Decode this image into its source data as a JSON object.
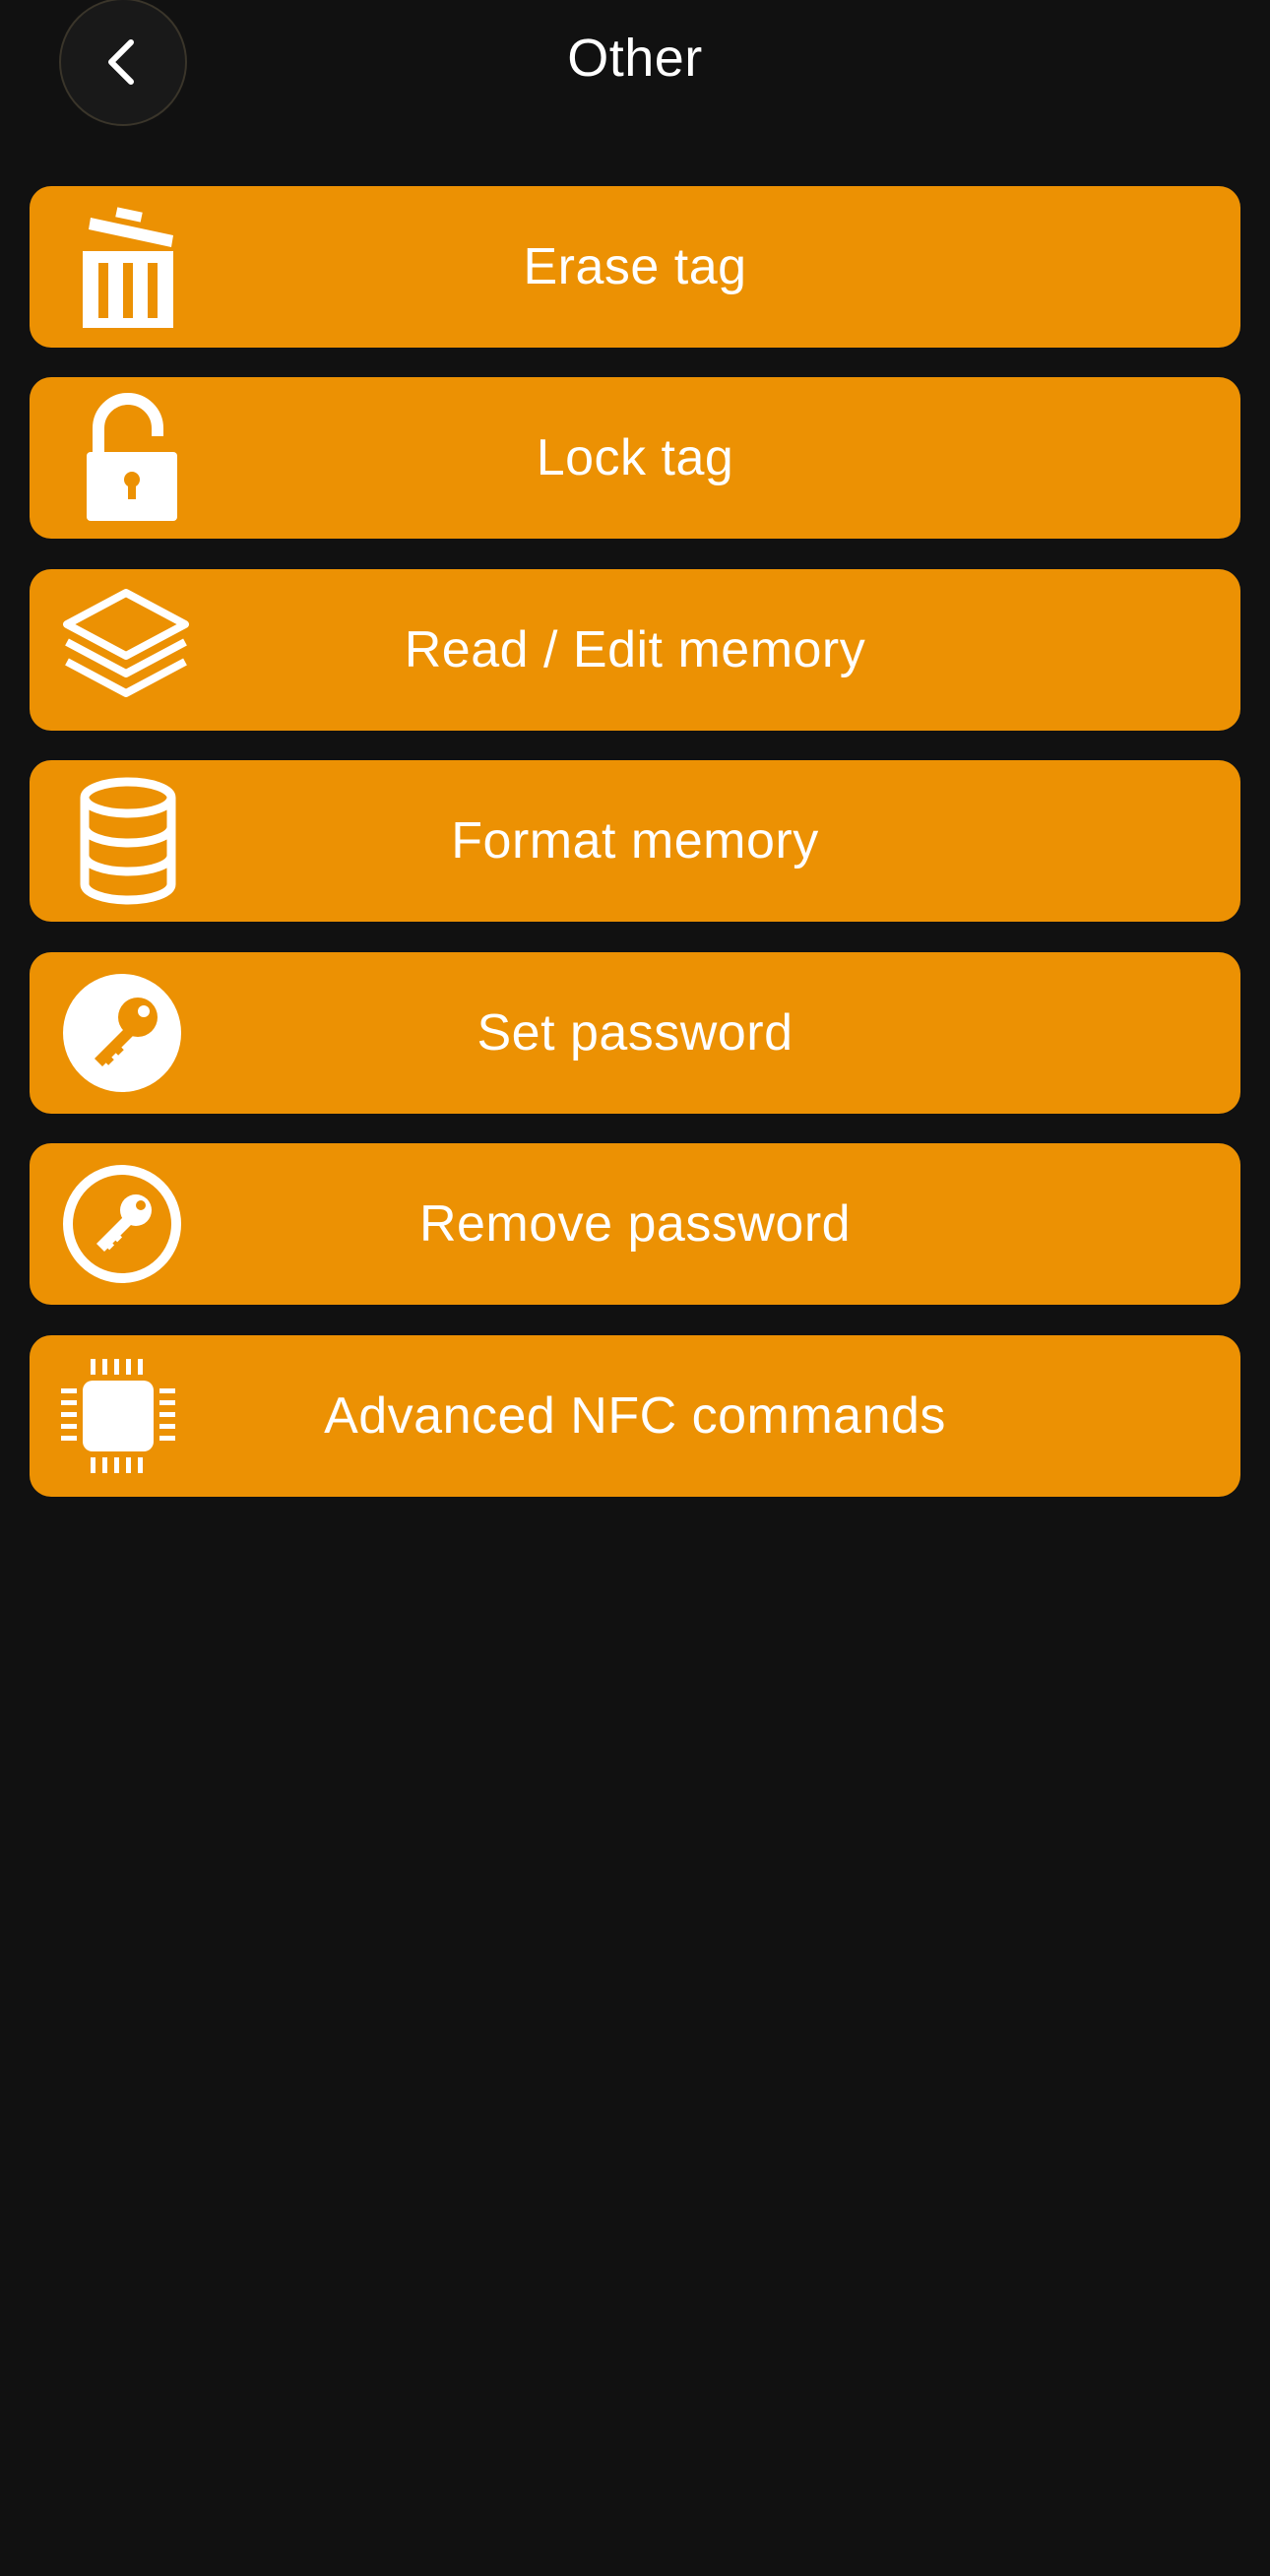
{
  "header": {
    "title": "Other",
    "back_icon": "chevron-left-icon"
  },
  "colors": {
    "background": "#111111",
    "accent": "#ec9103",
    "text": "#ffffff"
  },
  "menu": {
    "items": [
      {
        "label": "Erase tag",
        "icon": "trash-icon"
      },
      {
        "label": "Lock tag",
        "icon": "unlock-icon"
      },
      {
        "label": "Read / Edit memory",
        "icon": "layers-icon"
      },
      {
        "label": "Format memory",
        "icon": "database-icon"
      },
      {
        "label": "Set password",
        "icon": "key-circle-filled-icon"
      },
      {
        "label": "Remove password",
        "icon": "key-circle-outline-icon"
      },
      {
        "label": "Advanced NFC commands",
        "icon": "chip-icon"
      }
    ]
  }
}
